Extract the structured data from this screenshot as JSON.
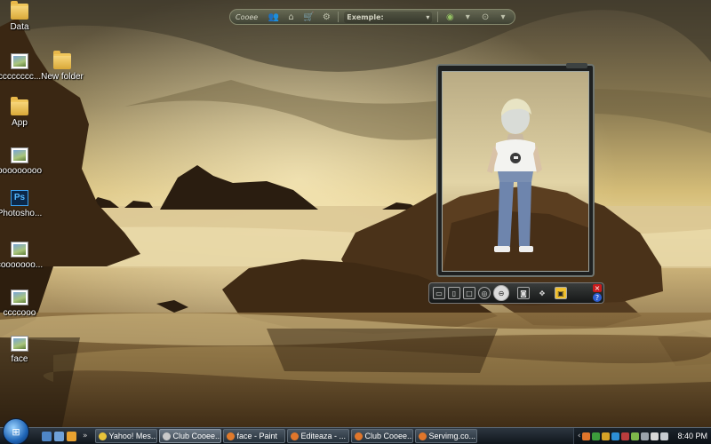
{
  "desktop": {
    "icons": [
      {
        "label": "Data",
        "type": "folder"
      },
      {
        "label": "cccccccc...",
        "type": "picture"
      },
      {
        "label": "New folder",
        "type": "folder"
      },
      {
        "label": "App",
        "type": "folder"
      },
      {
        "label": "ooooooooo",
        "type": "picture"
      },
      {
        "label": "Photosho...",
        "type": "photoshop"
      },
      {
        "label": "cooooooo...",
        "type": "picture"
      },
      {
        "label": "ccccooo",
        "type": "picture"
      },
      {
        "label": "face",
        "type": "picture"
      }
    ]
  },
  "toolbar": {
    "logo_text": "Cooee",
    "search_placeholder": "Exemple:",
    "icons": [
      "people-icon",
      "home-icon",
      "shop-icon",
      "gear-icon",
      "status-icon",
      "help-icon"
    ]
  },
  "avatar_widget": {
    "buttons": [
      "screen-icon",
      "screen-icon",
      "screen-icon",
      "globe-icon",
      "zoom-icon",
      "camera-icon",
      "arrows-icon",
      "gallery-icon"
    ],
    "close_label": "×",
    "help_label": "?"
  },
  "taskbar": {
    "start_label": "⊞",
    "tasks": [
      {
        "label": "Yahoo! Mes...",
        "color": "#e8c43a",
        "active": false
      },
      {
        "label": "Club Cooee...",
        "color": "#c9c9c9",
        "active": true
      },
      {
        "label": "face - Paint",
        "color": "#e07a2b",
        "active": false
      },
      {
        "label": "Editeaza - ...",
        "color": "#e0762b",
        "active": false
      },
      {
        "label": "Club Cooee...",
        "color": "#e0762b",
        "active": false
      },
      {
        "label": "Servimg.co...",
        "color": "#e0762b",
        "active": false
      }
    ],
    "clock": "8:40 PM"
  },
  "colors": {
    "sky": "#cdb36c",
    "sea": "#d7c28e",
    "rock": "#3f2a16"
  }
}
